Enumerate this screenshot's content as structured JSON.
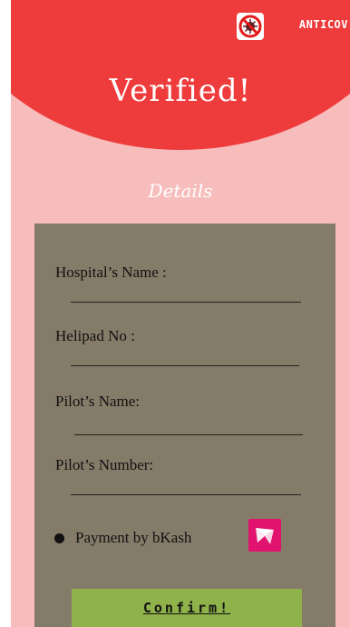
{
  "header": {
    "brand": "ANTICOV",
    "title": "Verified!",
    "logo_icon": "virus-prohibited-icon"
  },
  "details": {
    "heading": "Details",
    "fields": [
      {
        "label": "Hospital’s Name :",
        "value": ""
      },
      {
        "label": "Helipad No :",
        "value": ""
      },
      {
        "label": "Pilot’s Name:",
        "value": ""
      },
      {
        "label": "Pilot’s Number:",
        "value": ""
      }
    ],
    "payment_label": "Payment by bKash",
    "payment_icon": "bkash-bird-icon"
  },
  "actions": {
    "confirm_label": "Confirm!"
  },
  "colors": {
    "background": "#f7bcbc",
    "header": "#ee3b3b",
    "card": "#857b69",
    "confirm": "#8fb24a",
    "bkash": "#e2136e"
  }
}
